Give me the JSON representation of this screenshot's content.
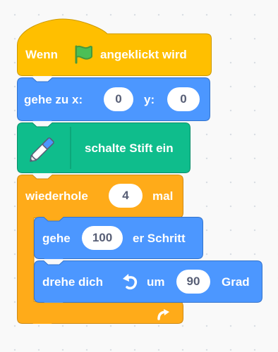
{
  "script": {
    "event_hat": {
      "word1": "Wenn",
      "icon": "green-flag-icon",
      "word2": "angeklickt wird"
    },
    "goto_xy": {
      "label": "gehe zu x:",
      "x_value": "0",
      "y_label": "y:",
      "y_value": "0"
    },
    "pen_down": {
      "icon": "pen-icon",
      "label": "schalte Stift ein"
    },
    "repeat": {
      "label": "wiederhole",
      "count": "4",
      "suffix": "mal",
      "loop_icon": "repeat-arrow-icon"
    },
    "move": {
      "label": "gehe",
      "steps": "100",
      "suffix": "er Schritt"
    },
    "turn": {
      "label": "drehe dich",
      "icon": "turn-left-icon",
      "um": "um",
      "degrees": "90",
      "suffix": "Grad"
    }
  },
  "colors": {
    "events": "#ffbf00",
    "motion": "#4c97ff",
    "pen": "#0fbd8c",
    "control": "#ffab19",
    "workspace": "#f9f9f9"
  }
}
